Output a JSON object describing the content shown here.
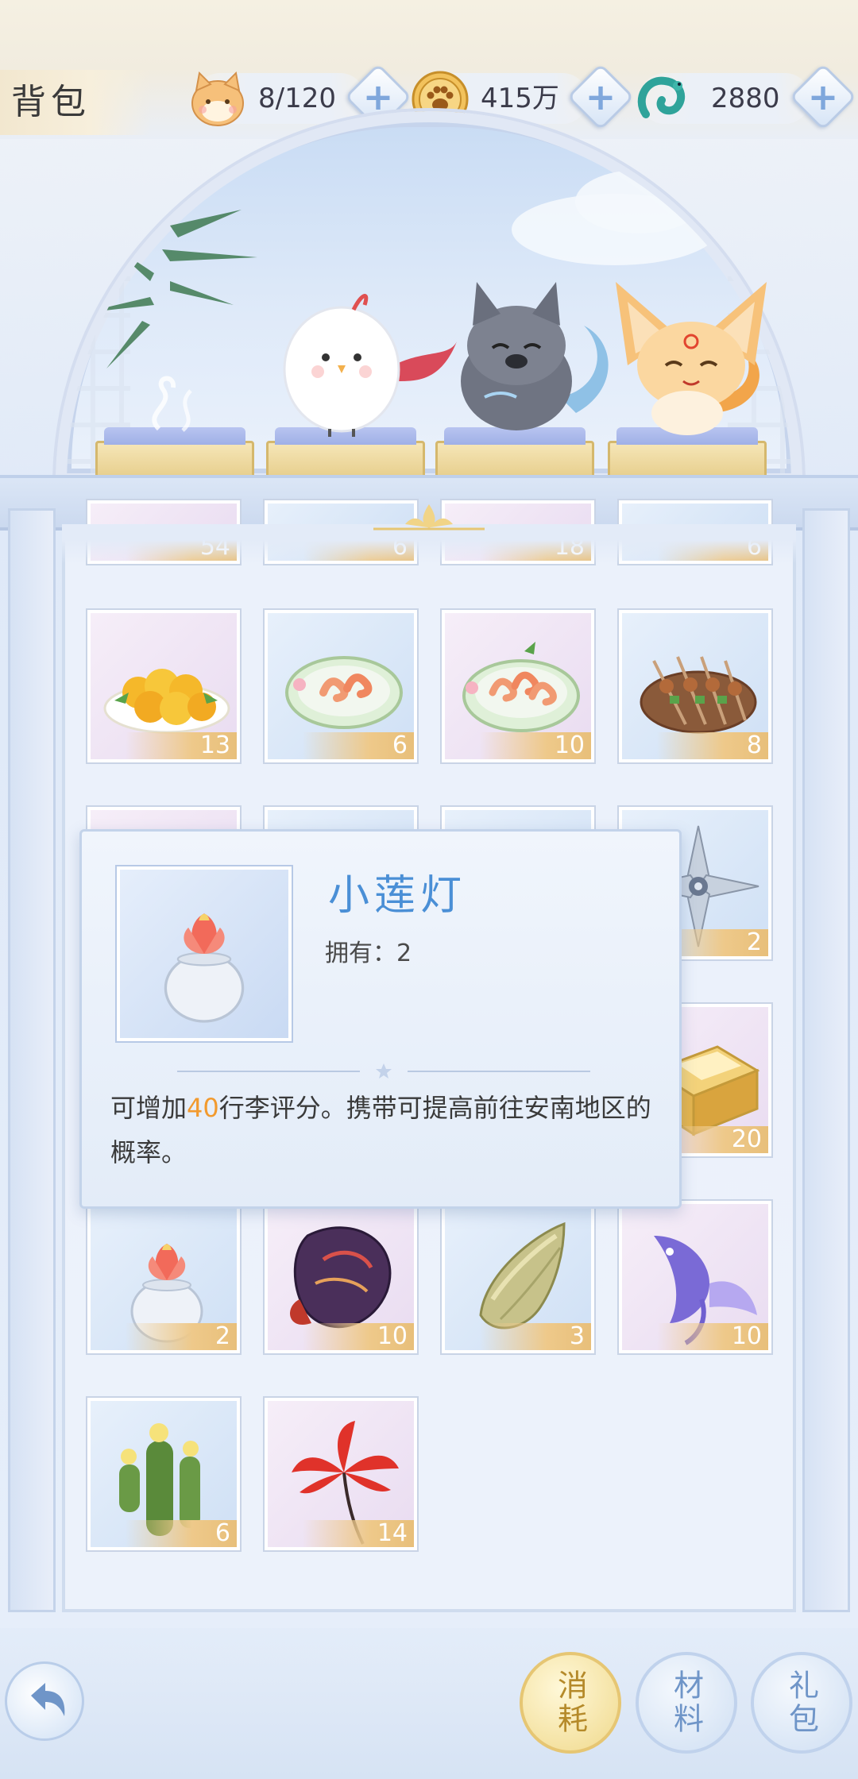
{
  "header": {
    "title": "背包",
    "resources": [
      {
        "name": "cat-capacity",
        "value": "8/120",
        "icon": "cat-face-icon"
      },
      {
        "name": "paw-coin",
        "value": "415万",
        "icon": "paw-coin-icon"
      },
      {
        "name": "jade-dragon",
        "value": "2880",
        "icon": "jade-dragon-icon"
      }
    ],
    "plus_label": "+"
  },
  "pets": [
    "incense-burner",
    "white-bird",
    "grey-wolf-pup",
    "orange-fox"
  ],
  "inventory": {
    "partial_row_quantities": [
      "54",
      "6",
      "18",
      "6"
    ],
    "row1": [
      {
        "name": "yellow-fruit-plate",
        "quantity": "13",
        "color": "pink"
      },
      {
        "name": "shrimp-dish",
        "quantity": "6",
        "color": "blue"
      },
      {
        "name": "shrimp-dish-deluxe",
        "quantity": "10",
        "color": "pink"
      },
      {
        "name": "skewer-plate",
        "quantity": "8",
        "color": "blue"
      }
    ],
    "row2": [
      {
        "name": "shuriken",
        "quantity": "2",
        "color": "blue"
      }
    ],
    "row3": [
      {
        "name": "golden-box",
        "quantity": "20",
        "color": "pink"
      }
    ],
    "row4": [
      {
        "name": "lotus-lamp",
        "quantity": "2",
        "color": "blue"
      },
      {
        "name": "purple-mask",
        "quantity": "10",
        "color": "pink"
      },
      {
        "name": "bamboo-shoot",
        "quantity": "3",
        "color": "blue"
      },
      {
        "name": "purple-fish",
        "quantity": "10",
        "color": "pink"
      }
    ],
    "row5": [
      {
        "name": "cactus",
        "quantity": "6",
        "color": "blue"
      },
      {
        "name": "red-spider-lily",
        "quantity": "14",
        "color": "pink"
      }
    ]
  },
  "tooltip": {
    "name": "小莲灯",
    "own_label": "拥有：",
    "own_value": "2",
    "desc_prefix": "可增加",
    "desc_highlight": "40",
    "desc_suffix": "行李评分。携带可提高前往安南地区的概率。"
  },
  "tabs": [
    {
      "label": "消耗",
      "active": true
    },
    {
      "label": "材料",
      "active": false
    },
    {
      "label": "礼包",
      "active": false
    }
  ],
  "colors": {
    "accent_blue": "#4a8fd6",
    "highlight_orange": "#f29a2e",
    "qty_gold": "#e8bf7a"
  }
}
